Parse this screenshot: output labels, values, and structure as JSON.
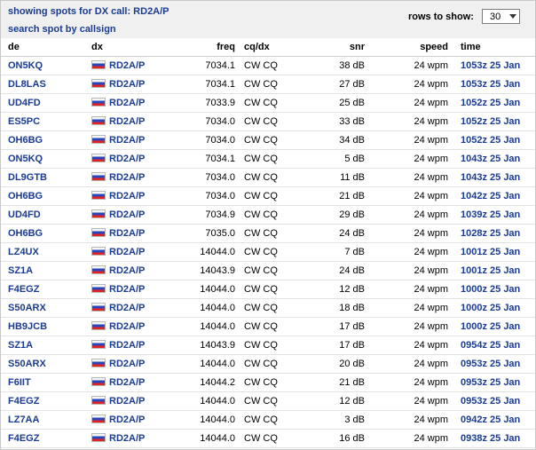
{
  "header": {
    "title": "showing spots for DX call: RD2A/P",
    "search_link": "search spot by callsign",
    "rows_label": "rows to show:",
    "rows_value": "30"
  },
  "columns": {
    "de": "de",
    "dx": "dx",
    "freq": "freq",
    "cq": "cq/dx",
    "snr": "snr",
    "speed": "speed",
    "time": "time"
  },
  "flag_icon": "russia-flag-icon",
  "colors": {
    "link": "#1a3b8f",
    "header_bg": "#f0f0f0"
  },
  "rows": [
    {
      "de": "ON5KQ",
      "dx": "RD2A/P",
      "freq": "7034.1",
      "cq": "CW CQ",
      "snr": "38 dB",
      "speed": "24 wpm",
      "time": "1053z 25 Jan"
    },
    {
      "de": "DL8LAS",
      "dx": "RD2A/P",
      "freq": "7034.1",
      "cq": "CW CQ",
      "snr": "27 dB",
      "speed": "24 wpm",
      "time": "1053z 25 Jan"
    },
    {
      "de": "UD4FD",
      "dx": "RD2A/P",
      "freq": "7033.9",
      "cq": "CW CQ",
      "snr": "25 dB",
      "speed": "24 wpm",
      "time": "1052z 25 Jan"
    },
    {
      "de": "ES5PC",
      "dx": "RD2A/P",
      "freq": "7034.0",
      "cq": "CW CQ",
      "snr": "33 dB",
      "speed": "24 wpm",
      "time": "1052z 25 Jan"
    },
    {
      "de": "OH6BG",
      "dx": "RD2A/P",
      "freq": "7034.0",
      "cq": "CW CQ",
      "snr": "34 dB",
      "speed": "24 wpm",
      "time": "1052z 25 Jan"
    },
    {
      "de": "ON5KQ",
      "dx": "RD2A/P",
      "freq": "7034.1",
      "cq": "CW CQ",
      "snr": "5 dB",
      "speed": "24 wpm",
      "time": "1043z 25 Jan"
    },
    {
      "de": "DL9GTB",
      "dx": "RD2A/P",
      "freq": "7034.0",
      "cq": "CW CQ",
      "snr": "11 dB",
      "speed": "24 wpm",
      "time": "1043z 25 Jan"
    },
    {
      "de": "OH6BG",
      "dx": "RD2A/P",
      "freq": "7034.0",
      "cq": "CW CQ",
      "snr": "21 dB",
      "speed": "24 wpm",
      "time": "1042z 25 Jan"
    },
    {
      "de": "UD4FD",
      "dx": "RD2A/P",
      "freq": "7034.9",
      "cq": "CW CQ",
      "snr": "29 dB",
      "speed": "24 wpm",
      "time": "1039z 25 Jan"
    },
    {
      "de": "OH6BG",
      "dx": "RD2A/P",
      "freq": "7035.0",
      "cq": "CW CQ",
      "snr": "24 dB",
      "speed": "24 wpm",
      "time": "1028z 25 Jan"
    },
    {
      "de": "LZ4UX",
      "dx": "RD2A/P",
      "freq": "14044.0",
      "cq": "CW CQ",
      "snr": "7 dB",
      "speed": "24 wpm",
      "time": "1001z 25 Jan"
    },
    {
      "de": "SZ1A",
      "dx": "RD2A/P",
      "freq": "14043.9",
      "cq": "CW CQ",
      "snr": "24 dB",
      "speed": "24 wpm",
      "time": "1001z 25 Jan"
    },
    {
      "de": "F4EGZ",
      "dx": "RD2A/P",
      "freq": "14044.0",
      "cq": "CW CQ",
      "snr": "12 dB",
      "speed": "24 wpm",
      "time": "1000z 25 Jan"
    },
    {
      "de": "S50ARX",
      "dx": "RD2A/P",
      "freq": "14044.0",
      "cq": "CW CQ",
      "snr": "18 dB",
      "speed": "24 wpm",
      "time": "1000z 25 Jan"
    },
    {
      "de": "HB9JCB",
      "dx": "RD2A/P",
      "freq": "14044.0",
      "cq": "CW CQ",
      "snr": "17 dB",
      "speed": "24 wpm",
      "time": "1000z 25 Jan"
    },
    {
      "de": "SZ1A",
      "dx": "RD2A/P",
      "freq": "14043.9",
      "cq": "CW CQ",
      "snr": "17 dB",
      "speed": "24 wpm",
      "time": "0954z 25 Jan"
    },
    {
      "de": "S50ARX",
      "dx": "RD2A/P",
      "freq": "14044.0",
      "cq": "CW CQ",
      "snr": "20 dB",
      "speed": "24 wpm",
      "time": "0953z 25 Jan"
    },
    {
      "de": "F6IIT",
      "dx": "RD2A/P",
      "freq": "14044.2",
      "cq": "CW CQ",
      "snr": "21 dB",
      "speed": "24 wpm",
      "time": "0953z 25 Jan"
    },
    {
      "de": "F4EGZ",
      "dx": "RD2A/P",
      "freq": "14044.0",
      "cq": "CW CQ",
      "snr": "12 dB",
      "speed": "24 wpm",
      "time": "0953z 25 Jan"
    },
    {
      "de": "LZ7AA",
      "dx": "RD2A/P",
      "freq": "14044.0",
      "cq": "CW CQ",
      "snr": "3 dB",
      "speed": "24 wpm",
      "time": "0942z 25 Jan"
    },
    {
      "de": "F4EGZ",
      "dx": "RD2A/P",
      "freq": "14044.0",
      "cq": "CW CQ",
      "snr": "16 dB",
      "speed": "24 wpm",
      "time": "0938z 25 Jan"
    }
  ]
}
